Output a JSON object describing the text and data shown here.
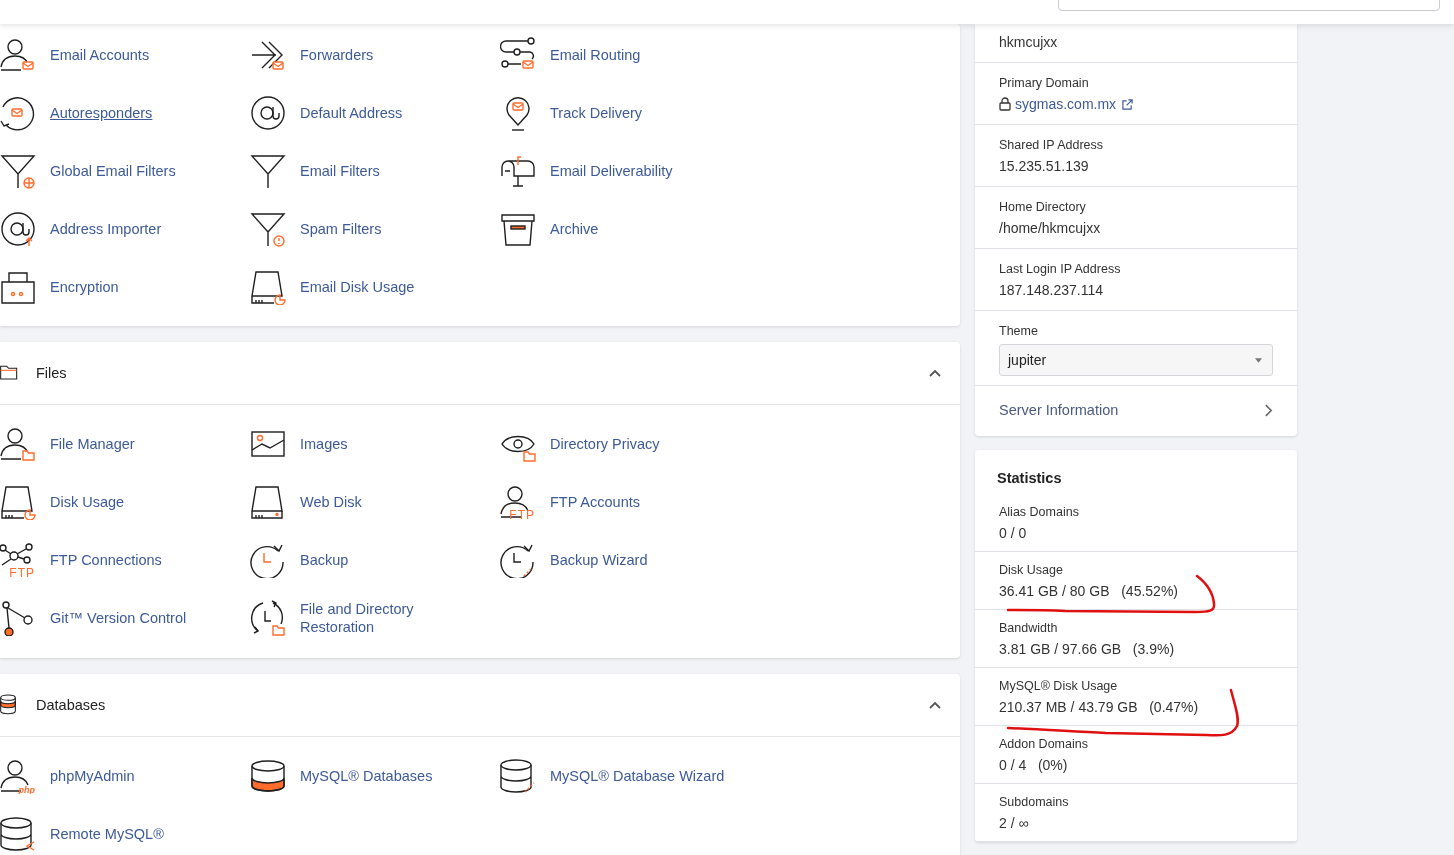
{
  "sections": [
    {
      "items": [
        {
          "label": "Email Accounts",
          "kind": "person-mail",
          "hovered": false
        },
        {
          "label": "Forwarders",
          "kind": "arrows-mail",
          "hovered": false
        },
        {
          "label": "Email Routing",
          "kind": "routing-mail",
          "hovered": false
        },
        {
          "label": "Autoresponders",
          "kind": "circle-mail",
          "hovered": true
        },
        {
          "label": "Default Address",
          "kind": "at",
          "hovered": false
        },
        {
          "label": "Track Delivery",
          "kind": "pin-mail",
          "hovered": false
        },
        {
          "label": "Global Email Filters",
          "kind": "funnel-globe",
          "hovered": false
        },
        {
          "label": "Email Filters",
          "kind": "funnel",
          "hovered": false
        },
        {
          "label": "Email Deliverability",
          "kind": "mailbox",
          "hovered": false
        },
        {
          "label": "Address Importer",
          "kind": "at-up",
          "hovered": false
        },
        {
          "label": "Spam Filters",
          "kind": "funnel-alert",
          "hovered": false
        },
        {
          "label": "Archive",
          "kind": "archive",
          "hovered": false
        },
        {
          "label": "Encryption",
          "kind": "keypad",
          "hovered": false
        },
        {
          "label": "Email Disk Usage",
          "kind": "disk-chart",
          "hovered": false
        }
      ]
    },
    {
      "title": "Files",
      "kind": "folder",
      "expanded": true,
      "items": [
        {
          "label": "File Manager",
          "kind": "person-folder",
          "hovered": false
        },
        {
          "label": "Images",
          "kind": "image",
          "hovered": false
        },
        {
          "label": "Directory Privacy",
          "kind": "eye-folder",
          "hovered": false
        },
        {
          "label": "Disk Usage",
          "kind": "disk-chart",
          "hovered": false
        },
        {
          "label": "Web Disk",
          "kind": "disk",
          "hovered": false
        },
        {
          "label": "FTP Accounts",
          "kind": "person",
          "icon_text": "FTP",
          "hovered": false
        },
        {
          "label": "FTP Connections",
          "kind": "network",
          "icon_text": "FTP",
          "hovered": false
        },
        {
          "label": "Backup",
          "kind": "clock",
          "hovered": false
        },
        {
          "label": "Backup Wizard",
          "kind": "clock-wand",
          "hovered": false
        },
        {
          "label": "Git™ Version Control",
          "kind": "git",
          "hovered": false
        },
        {
          "label": "File and Directory Restoration",
          "kind": "restore",
          "hovered": false
        }
      ]
    },
    {
      "title": "Databases",
      "kind": "db-stack",
      "expanded": true,
      "items": [
        {
          "label": "phpMyAdmin",
          "kind": "person",
          "icon_text": "php",
          "hovered": false
        },
        {
          "label": "MySQL® Databases",
          "kind": "db-orange",
          "hovered": false
        },
        {
          "label": "MySQL® Database Wizard",
          "kind": "db-wand",
          "hovered": false
        },
        {
          "label": "Remote MySQL®",
          "kind": "db-remote",
          "hovered": false
        }
      ]
    }
  ],
  "account": {
    "rows": [
      {
        "kind": "text",
        "value": "hkmcujxx"
      },
      {
        "kind": "domain",
        "label": "Primary Domain",
        "value": "sygmas.com.mx"
      },
      {
        "kind": "text",
        "label": "Shared IP Address",
        "value": "15.235.51.139"
      },
      {
        "kind": "text",
        "label": "Home Directory",
        "value": "/home/hkmcujxx"
      },
      {
        "kind": "text",
        "label": "Last Login IP Address",
        "value": "187.148.237.114"
      },
      {
        "kind": "select",
        "label": "Theme",
        "value": "jupiter"
      },
      {
        "kind": "link",
        "value": "Server Information"
      }
    ]
  },
  "statistics": {
    "title": "Statistics",
    "rows": [
      {
        "label": "Alias Domains",
        "value": "0 / 0",
        "annotated": false
      },
      {
        "label": "Disk Usage",
        "value": "36.41 GB / 80 GB   (45.52%)",
        "annotated": true
      },
      {
        "label": "Bandwidth",
        "value": "3.81 GB / 97.66 GB   (3.9%)",
        "annotated": false
      },
      {
        "label": "MySQL® Disk Usage",
        "value": "210.37 MB / 43.79 GB   (0.47%)",
        "annotated": true
      },
      {
        "label": "Addon Domains",
        "value": "0 / 4   (0%)",
        "annotated": false
      },
      {
        "label": "Subdomains",
        "value": "2 / ∞",
        "annotated": false
      }
    ]
  }
}
